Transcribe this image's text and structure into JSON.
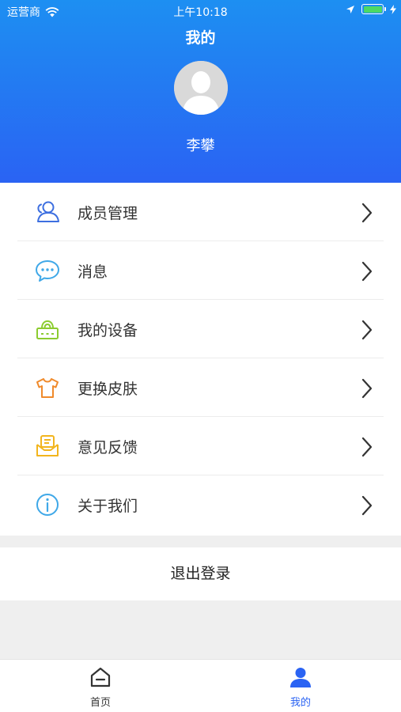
{
  "status_bar": {
    "carrier": "运营商",
    "time": "上午10:18"
  },
  "header": {
    "title": "我的",
    "user_name": "李攀"
  },
  "colors": {
    "accent": "#2a63f3",
    "header_top": "#1d8ff2",
    "battery": "#4cd964"
  },
  "menu": [
    {
      "label": "成员管理",
      "icon": "members-icon"
    },
    {
      "label": "消息",
      "icon": "message-icon"
    },
    {
      "label": "我的设备",
      "icon": "device-icon"
    },
    {
      "label": "更换皮肤",
      "icon": "skin-icon"
    },
    {
      "label": "意见反馈",
      "icon": "feedback-icon"
    },
    {
      "label": "关于我们",
      "icon": "info-icon"
    }
  ],
  "logout_label": "退出登录",
  "tabbar": {
    "tabs": [
      {
        "label": "首页",
        "icon": "home-icon",
        "active": false
      },
      {
        "label": "我的",
        "icon": "profile-icon",
        "active": true
      }
    ]
  }
}
